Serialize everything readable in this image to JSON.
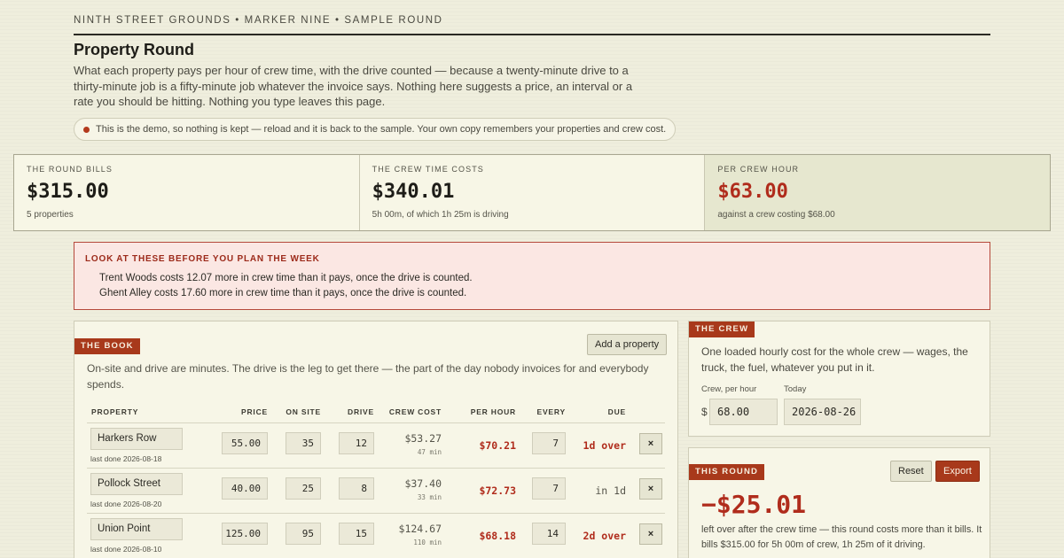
{
  "header": {
    "kicker": "NINTH STREET GROUNDS • MARKER NINE • SAMPLE ROUND",
    "title": "Property Round",
    "intro": "What each property pays per hour of crew time, with the drive counted — because a twenty-minute drive to a thirty-minute job is a fifty-minute job whatever the invoice says. Nothing here suggests a price, an interval or a rate you should be hitting. Nothing you type leaves this page.",
    "demo_notice": "This is the demo, so nothing is kept — reload and it is back to the sample. Your own copy remembers your properties and crew cost."
  },
  "stats": [
    {
      "label": "THE ROUND BILLS",
      "value": "$315.00",
      "sub": "5 properties"
    },
    {
      "label": "THE CREW TIME COSTS",
      "value": "$340.01",
      "sub": "5h 00m, of which 1h 25m is driving"
    },
    {
      "label": "PER CREW HOUR",
      "value": "$63.00",
      "sub": "against a crew costing $68.00"
    }
  ],
  "warning": {
    "title": "LOOK AT THESE BEFORE YOU PLAN THE WEEK",
    "lines": [
      "Trent Woods costs 12.07 more in crew time than it pays, once the drive is counted.",
      "Ghent Alley costs 17.60 more in crew time than it pays, once the drive is counted."
    ]
  },
  "book": {
    "tag": "THE BOOK",
    "add_label": "Add a property",
    "desc": "On-site and drive are minutes. The drive is the leg to get there — the part of the day nobody invoices for and everybody spends.",
    "columns": {
      "property": "PROPERTY",
      "price": "PRICE",
      "on_site": "ON SITE",
      "drive": "DRIVE",
      "crew_cost": "CREW COST",
      "per_hour": "PER HOUR",
      "every": "EVERY",
      "due": "DUE"
    },
    "rows": [
      {
        "name": "Harkers Row",
        "last_done": "last done 2026-08-18",
        "price": "55.00",
        "on_site": "35",
        "drive": "12",
        "crew_cost": "$53.27",
        "crew_min": "47 min",
        "per_hour": "$70.21",
        "every": "7",
        "due": "1d over",
        "due_state": "over",
        "remove": "×"
      },
      {
        "name": "Pollock Street",
        "last_done": "last done 2026-08-20",
        "price": "40.00",
        "on_site": "25",
        "drive": "8",
        "crew_cost": "$37.40",
        "crew_min": "33 min",
        "per_hour": "$72.73",
        "every": "7",
        "due": "in 1d",
        "due_state": "ok",
        "remove": "×"
      },
      {
        "name": "Union Point",
        "last_done": "last done 2026-08-10",
        "price": "125.00",
        "on_site": "95",
        "drive": "15",
        "crew_cost": "$124.67",
        "crew_min": "110 min",
        "per_hour": "$68.18",
        "every": "14",
        "due": "2d over",
        "due_state": "over",
        "remove": "×"
      }
    ]
  },
  "crew": {
    "tag": "THE CREW",
    "desc": "One loaded hourly cost for the whole crew — wages, the truck, the fuel, whatever you put in it.",
    "rate_label": "Crew, per hour",
    "currency": "$",
    "rate_value": "68.00",
    "today_label": "Today",
    "today_value": "2026-08-26"
  },
  "round": {
    "tag": "THIS ROUND",
    "reset_label": "Reset",
    "export_label": "Export",
    "value": "−$25.01",
    "desc": "left over after the crew time — this round costs more than it bills. It bills $315.00 for 5h 00m of crew, 1h 25m of it driving."
  },
  "colors": {
    "accent": "#a8391b",
    "negative": "#b02c1c",
    "background": "#efeedd"
  }
}
